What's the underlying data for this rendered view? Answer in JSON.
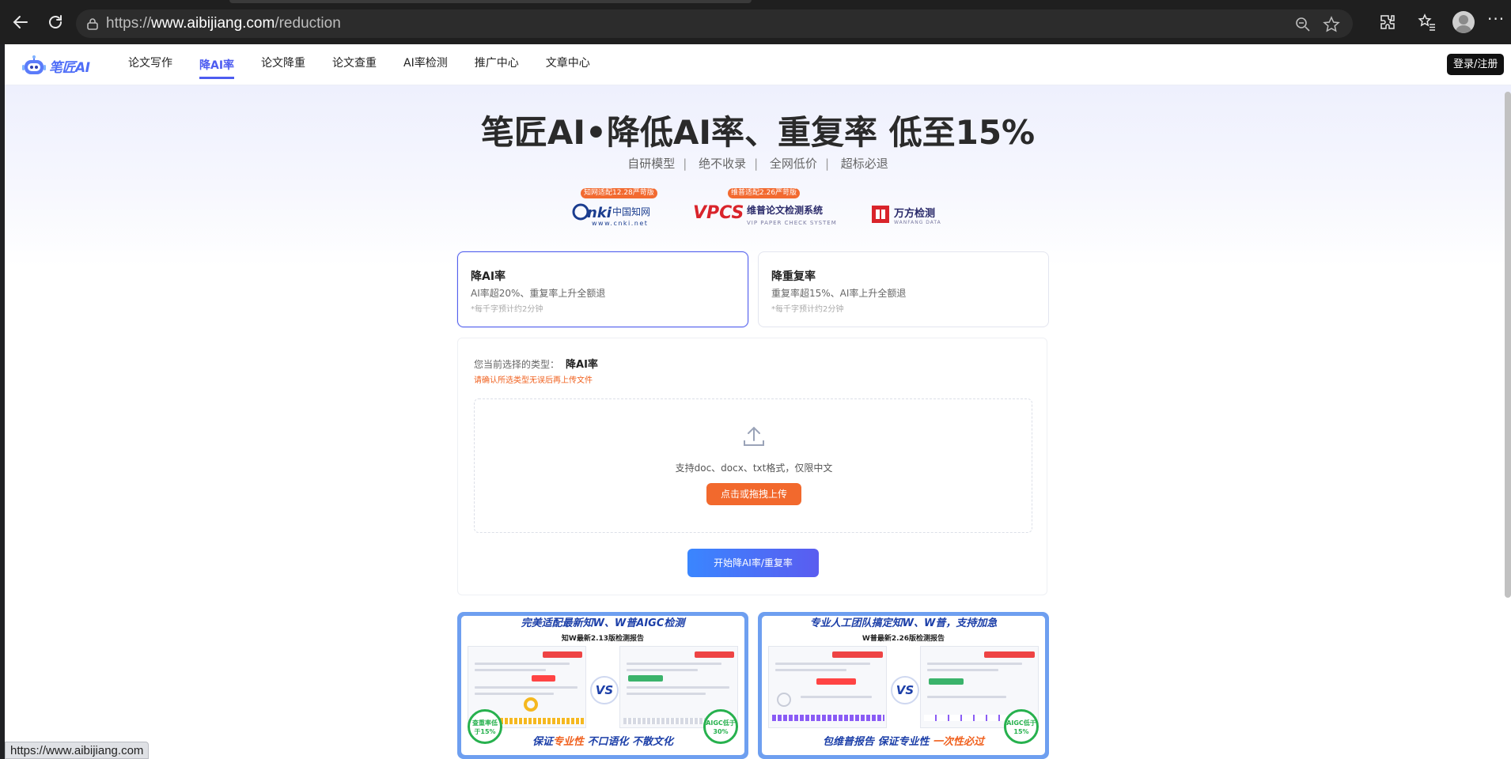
{
  "browser": {
    "url_prefix": "https://",
    "url_host": "www.aibijiang.com",
    "url_path": "/reduction"
  },
  "site": {
    "logo_text": "笔匠AI",
    "nav": [
      "论文写作",
      "降AI率",
      "论文降重",
      "论文查重",
      "AI率检测",
      "推广中心",
      "文章中心"
    ],
    "active_nav": "降AI率",
    "login_label": "登录/注册"
  },
  "hero": {
    "title": "笔匠AI•降低AI率、重复率 低至15%",
    "features": [
      "自研模型",
      "绝不收录",
      "全网低价",
      "超标必退"
    ],
    "partners": [
      {
        "name": "CNKI中国知网",
        "url_text": "www.cnki.net",
        "badge": "知网适配12.28严苛版"
      },
      {
        "name": "VPCS 维普论文检测系统",
        "sub_text": "VIP PAPER CHECK SYSTEM",
        "badge": "维普适配2.26严苛版"
      },
      {
        "name": "万方检测",
        "sub_text": "WANFANG DATA"
      }
    ]
  },
  "modes": [
    {
      "title": "降AI率",
      "desc": "AI率超20%、重复率上升全额退",
      "note": "*每千字预计约2分钟",
      "selected": true
    },
    {
      "title": "降重复率",
      "desc": "重复率超15%、AI率上升全额退",
      "note": "*每千字预计约2分钟",
      "selected": false
    }
  ],
  "upload": {
    "selected_label": "您当前选择的类型：",
    "selected_value": "降AI率",
    "warning": "请确认所选类型无误后再上传文件",
    "formats": "支持doc、docx、txt格式，仅限中文",
    "upload_button": "点击或拖拽上传",
    "start_button": "开始降AI率/重复率"
  },
  "promos": [
    {
      "headline": "完美适配最新知W、W普AIGC检测",
      "subtitle": "知W最新2.13版检测报告",
      "vs": "VS",
      "footer_a": "保证",
      "footer_hl": "专业性",
      "footer_b": "不口语化 不散文化",
      "seal_left": "查重率低于15%",
      "seal_right": "AIGC低于30%"
    },
    {
      "headline": "专业人工团队搞定知W、W普，支持加急",
      "subtitle": "W普最新2.26版检测报告",
      "vs": "VS",
      "footer_a": "包维普报告 保证专业性 ",
      "footer_hl": "一次性必过",
      "footer_b": "",
      "seal_right": "AIGC低于15%"
    }
  ],
  "status_bar": "https://www.aibijiang.com",
  "colors": {
    "accent": "#4d5cf0",
    "orange": "#f2692d",
    "blue_start": "#3a86ff"
  }
}
